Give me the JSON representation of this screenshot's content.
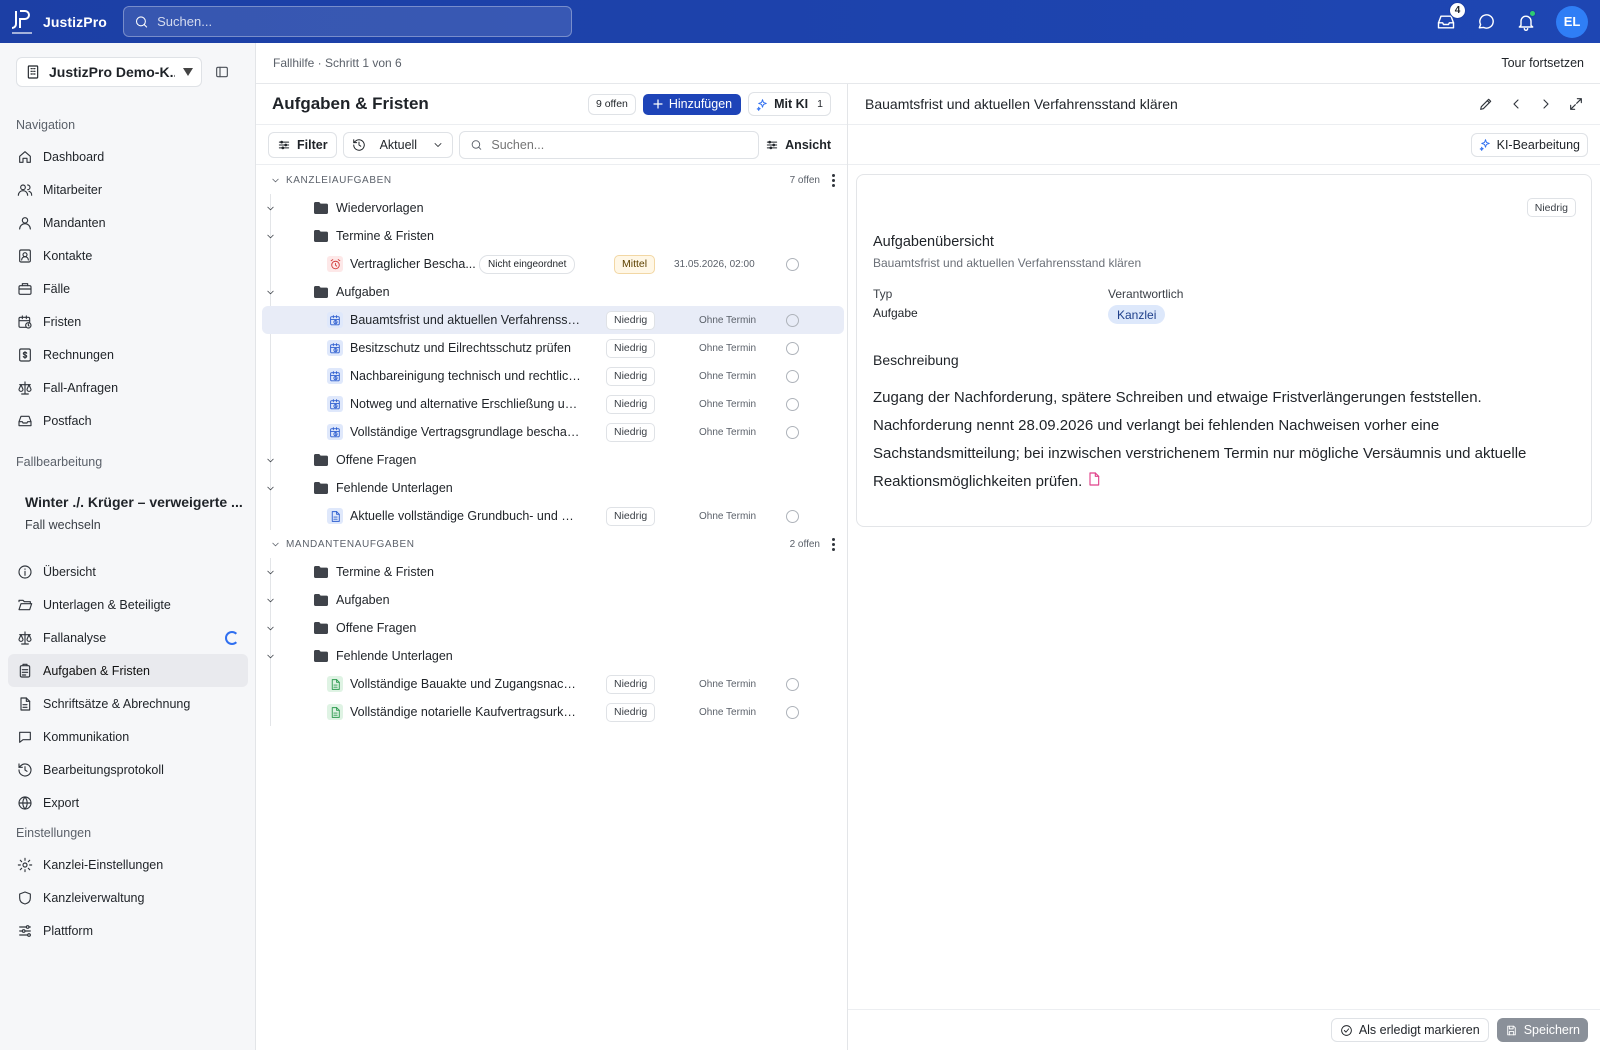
{
  "app": {
    "name": "JustizPro",
    "logo_sub": "JUSTIZPRO"
  },
  "topbar": {
    "search_placeholder": "Suchen...",
    "inbox_badge": "4",
    "avatar_initials": "EL"
  },
  "sidebar": {
    "tenant": "JustizPro Demo-K...",
    "nav_heading": "Navigation",
    "nav": [
      {
        "label": "Dashboard",
        "icon": "home-icon"
      },
      {
        "label": "Mitarbeiter",
        "icon": "users-icon"
      },
      {
        "label": "Mandanten",
        "icon": "user-icon"
      },
      {
        "label": "Kontakte",
        "icon": "contacts-icon"
      },
      {
        "label": "Fälle",
        "icon": "briefcase-icon"
      },
      {
        "label": "Fristen",
        "icon": "calendar-clock-icon"
      },
      {
        "label": "Rechnungen",
        "icon": "invoice-icon"
      },
      {
        "label": "Fall-Anfragen",
        "icon": "scales-icon"
      },
      {
        "label": "Postfach",
        "icon": "inbox-icon"
      }
    ],
    "case_heading": "Fallbearbeitung",
    "case_name": "Winter ./. Krüger – verweigerte ...",
    "case_change": "Fall wechseln",
    "case_nav": [
      {
        "label": "Übersicht",
        "icon": "info-icon"
      },
      {
        "label": "Unterlagen & Beteiligte",
        "icon": "folder-open-icon"
      },
      {
        "label": "Fallanalyse",
        "icon": "scales-icon"
      },
      {
        "label": "Aufgaben & Fristen",
        "icon": "clipboard-icon",
        "active": true
      },
      {
        "label": "Schriftsätze & Abrechnung",
        "icon": "document-icon"
      },
      {
        "label": "Kommunikation",
        "icon": "chat-icon"
      },
      {
        "label": "Bearbeitungsprotokoll",
        "icon": "history-icon"
      },
      {
        "label": "Export",
        "icon": "globe-icon"
      }
    ],
    "settings_heading": "Einstellungen",
    "settings_nav": [
      {
        "label": "Kanzlei-Einstellungen",
        "icon": "gear-icon"
      },
      {
        "label": "Kanzleiverwaltung",
        "icon": "shield-icon"
      },
      {
        "label": "Plattform",
        "icon": "sliders-icon"
      }
    ]
  },
  "tour": {
    "step": "Fallhilfe · Schritt 1 von 6",
    "continue": "Tour fortsetzen"
  },
  "list": {
    "title": "Aufgaben & Fristen",
    "open_count": "9 offen",
    "add_label": "Hinzufügen",
    "ki_label": "Mit KI",
    "ki_count": "1",
    "filter_label": "Filter",
    "scope_label": "Aktuell",
    "search_placeholder": "Suchen...",
    "view_label": "Ansicht",
    "groups": [
      {
        "name": "KANZLEIAUFGABEN",
        "count": "7 offen",
        "folders": [
          {
            "name": "Wiedervorlagen",
            "items": []
          },
          {
            "name": "Termine & Fristen",
            "items": [
              {
                "title": "Vertraglicher Bescha...",
                "type": "deadline",
                "tag": "Nicht eingeordnet",
                "priority": "Mittel",
                "due": "31.05.2026, 02:00"
              }
            ]
          },
          {
            "name": "Aufgaben",
            "items": [
              {
                "title": "Bauamtsfrist und aktuellen Verfahrenssta...",
                "type": "task",
                "priority": "Niedrig",
                "due": "Ohne Termin",
                "selected": true
              },
              {
                "title": "Besitzschutz und Eilrechtsschutz prüfen",
                "type": "task",
                "priority": "Niedrig",
                "due": "Ohne Termin"
              },
              {
                "title": "Nachbareinigung technisch und rechtlich ...",
                "type": "task",
                "priority": "Niedrig",
                "due": "Ohne Termin"
              },
              {
                "title": "Notweg und alternative Erschließung unt...",
                "type": "task",
                "priority": "Niedrig",
                "due": "Ohne Termin"
              },
              {
                "title": "Vollständige Vertragsgrundlage beschaff...",
                "type": "task",
                "priority": "Niedrig",
                "due": "Ohne Termin"
              }
            ]
          },
          {
            "name": "Offene Fragen",
            "items": []
          },
          {
            "name": "Fehlende Unterlagen",
            "items": [
              {
                "title": "Aktuelle vollständige Grundbuch- und Sic...",
                "type": "doc-blue",
                "priority": "Niedrig",
                "due": "Ohne Termin"
              }
            ]
          }
        ]
      },
      {
        "name": "MANDANTENAUFGABEN",
        "count": "2 offen",
        "folders": [
          {
            "name": "Termine & Fristen",
            "items": []
          },
          {
            "name": "Aufgaben",
            "items": []
          },
          {
            "name": "Offene Fragen",
            "items": []
          },
          {
            "name": "Fehlende Unterlagen",
            "items": [
              {
                "title": "Vollständige Bauakte und Zugangsnachw...",
                "type": "doc-green",
                "priority": "Niedrig",
                "due": "Ohne Termin"
              },
              {
                "title": "Vollständige notarielle Kaufvertragsurkun...",
                "type": "doc-green",
                "priority": "Niedrig",
                "due": "Ohne Termin"
              }
            ]
          }
        ]
      }
    ]
  },
  "detail": {
    "title": "Bauamtsfrist und aktuellen Verfahrensstand klären",
    "ki_edit": "KI-Bearbeitung",
    "priority": "Niedrig",
    "overview_title": "Aufgabenübersicht",
    "overview_sub": "Bauamtsfrist und aktuellen Verfahrensstand klären",
    "type_label": "Typ",
    "type_value": "Aufgabe",
    "resp_label": "Verantwortlich",
    "resp_value": "Kanzlei",
    "desc_label": "Beschreibung",
    "desc_text": "Zugang der Nachforderung, spätere Schreiben und etwaige Fristverlängerungen feststellen. Nachforderung nennt 28.09.2026 und verlangt bei fehlenden Nachweisen vorher eine Sachstandsmitteilung; bei inzwischen verstrichenem Termin nur mögliche Versäumnis und aktuelle Reaktionsmöglichkeiten prüfen.",
    "done_label": "Als erledigt markieren",
    "save_label": "Speichern"
  }
}
